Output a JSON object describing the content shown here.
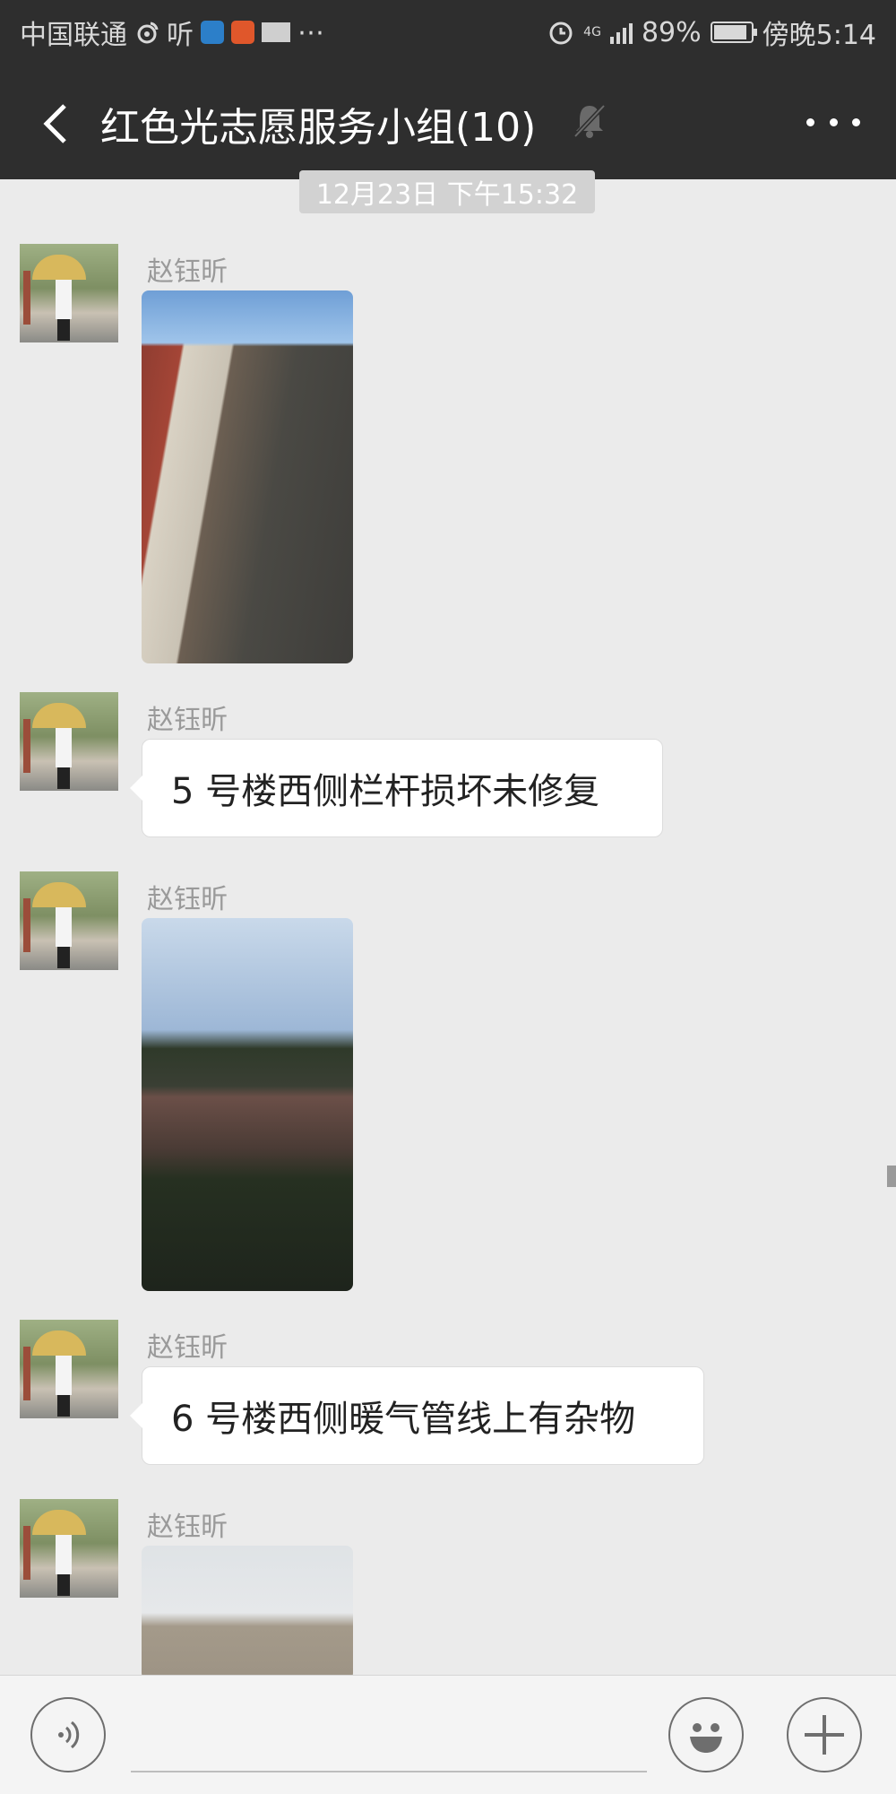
{
  "status_bar": {
    "carrier": "中国联通",
    "app_label": "听",
    "network": "4G",
    "battery_percent": "89%",
    "time": "傍晚5:14",
    "icons": [
      "weibo-icon",
      "shield-icon",
      "video-icon",
      "mail-icon",
      "more-dots-icon",
      "alarm-icon",
      "signal-icon",
      "battery-icon"
    ],
    "battery_level": 0.89
  },
  "header": {
    "title": "红色光志愿服务小组(10)",
    "icons": [
      "back-arrow-icon",
      "mute-bell-icon",
      "more-icon"
    ]
  },
  "timestamp": "12月23日 下午15:32",
  "messages": [
    {
      "sender": "赵钰昕",
      "type": "image"
    },
    {
      "sender": "赵钰昕",
      "type": "text",
      "text": "5 号楼西侧栏杆损坏未修复"
    },
    {
      "sender": "赵钰昕",
      "type": "image"
    },
    {
      "sender": "赵钰昕",
      "type": "text",
      "text": "6 号楼西侧暖气管线上有杂物"
    },
    {
      "sender": "赵钰昕",
      "type": "image"
    }
  ],
  "input_bar": {
    "icons": [
      "voice-icon",
      "emoji-icon",
      "plus-icon"
    ],
    "text_value": ""
  },
  "colors": {
    "header_bg": "#2e2e2e",
    "chat_bg": "#ebebeb",
    "bubble_bg": "#ffffff",
    "sender_text": "#9a9a9a"
  }
}
